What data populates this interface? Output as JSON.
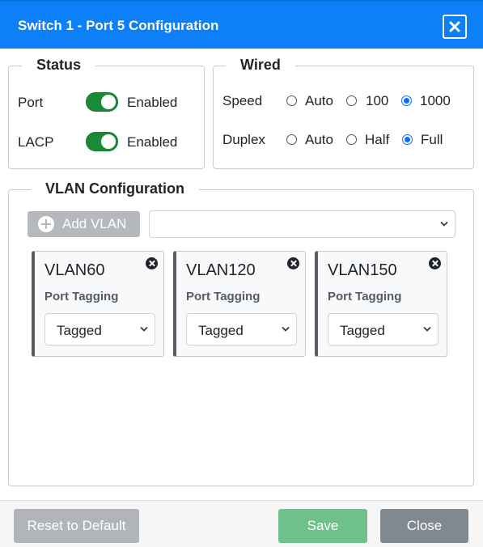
{
  "dialog": {
    "title": "Switch 1 - Port 5 Configuration"
  },
  "status": {
    "legend": "Status",
    "port": {
      "label": "Port",
      "state": "Enabled",
      "on": true
    },
    "lacp": {
      "label": "LACP",
      "state": "Enabled",
      "on": true
    }
  },
  "wired": {
    "legend": "Wired",
    "speed": {
      "label": "Speed",
      "options": [
        "Auto",
        "100",
        "1000"
      ],
      "selected": "1000"
    },
    "duplex": {
      "label": "Duplex",
      "options": [
        "Auto",
        "Half",
        "Full"
      ],
      "selected": "Full"
    }
  },
  "vlan": {
    "legend": "VLAN Configuration",
    "add_button": "Add VLAN",
    "select_value": "",
    "cards": [
      {
        "name": "VLAN60",
        "tagging_label": "Port Tagging",
        "tagging": "Tagged"
      },
      {
        "name": "VLAN120",
        "tagging_label": "Port Tagging",
        "tagging": "Tagged"
      },
      {
        "name": "VLAN150",
        "tagging_label": "Port Tagging",
        "tagging": "Tagged"
      }
    ]
  },
  "footer": {
    "reset": "Reset to Default",
    "save": "Save",
    "close": "Close"
  },
  "colors": {
    "header": "#0d7ff7",
    "toggle_on": "#1a8a34",
    "radio_checked": "#0d6efd",
    "save": "#6fc18c",
    "close": "#818990"
  }
}
